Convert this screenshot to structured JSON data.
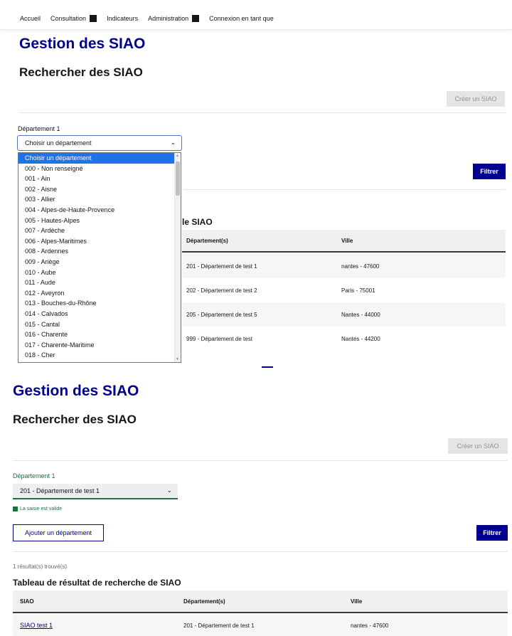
{
  "nav": {
    "items": [
      "Accueil",
      "Consultation",
      "Indicateurs",
      "Administration",
      "Connexion en tant que"
    ]
  },
  "page1": {
    "title": "Gestion des SIAO",
    "subtitle": "Rechercher des SIAO",
    "create_button": "Créer un SIAO",
    "dept_label": "Département 1",
    "select_value": "Choisir un département",
    "filter_button": "Filtrer",
    "table_title_partial": "le SIAO",
    "columns": [
      "Département(s)",
      "Ville"
    ],
    "rows": [
      [
        "201 - Département de test 1",
        "nantes - 47600"
      ],
      [
        "202 - Département de test 2",
        "Paris - 75001"
      ],
      [
        "205 - Département de test 5",
        "Nantes - 44000"
      ],
      [
        "999 - Département de test",
        "Nantes - 44200"
      ]
    ]
  },
  "dropdown": {
    "options": [
      "Choisir un département",
      "000 - Non renseigné",
      "001 - Ain",
      "002 - Aisne",
      "003 - Allier",
      "004 - Alpes-de-Haute-Provence",
      "005 - Hautes-Alpes",
      "007 - Ardèche",
      "006 - Alpes-Maritimes",
      "008 - Ardennes",
      "009 - Ariège",
      "010 - Aube",
      "011 - Aude",
      "012 - Aveyron",
      "013 - Bouches-du-Rhône",
      "014 - Calvados",
      "015 - Cantal",
      "016 - Charente",
      "017 - Charente-Maritime",
      "018 - Cher"
    ]
  },
  "page2": {
    "title": "Gestion des SIAO",
    "subtitle": "Rechercher des SIAO",
    "create_button": "Créer un SIAO",
    "dept_label": "Département 1",
    "select_value": "201 - Département de test 1",
    "valid_message": "La saisie est valide",
    "add_button": "Ajouter un département",
    "filter_button": "Filtrer",
    "results_count": "1 résultat(s) trouvé(s)",
    "table_title": "Tableau de résultat de recherche de SIAO",
    "columns": [
      "SIAO",
      "Département(s)",
      "Ville"
    ],
    "rows": [
      [
        "SIAO test 1",
        "201 - Département de test 1",
        "nantes - 47600"
      ]
    ]
  },
  "colors": {
    "primary": "#000091",
    "valid": "#18753c",
    "selected_option": "#1e73e8"
  },
  "icons": [
    "chevron-down-icon",
    "square-icon",
    "check-square-icon"
  ]
}
